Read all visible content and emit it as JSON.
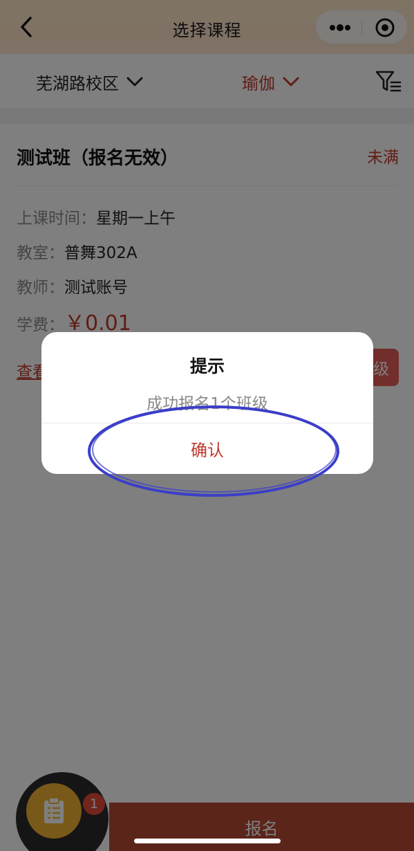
{
  "navbar": {
    "title": "选择课程",
    "back_icon": "chevron-left-icon",
    "more_icon": "more-dots-icon",
    "close_icon": "target-close-icon"
  },
  "filters": {
    "campus_label": "芜湖路校区",
    "course_label": "瑜伽",
    "filter_icon": "filter-icon"
  },
  "course_card": {
    "title": "测试班（报名无效）",
    "status": "未满",
    "time_label": "上课时间：",
    "time_value": "星期一上午",
    "room_label": "教室：",
    "room_value": "普舞302A",
    "teacher_label": "教师：",
    "teacher_value": "测试账号",
    "fee_label": "学费：",
    "fee_value": "￥0.01",
    "link_text": "查看",
    "action_text": "级"
  },
  "bottom_bar": {
    "cart_badge": "1",
    "register_label": "报名"
  },
  "dialog": {
    "title": "提示",
    "content": "成功报名1个班级",
    "confirm_label": "确认"
  },
  "colors": {
    "accent": "#c0392b",
    "register_bg": "#b84a35",
    "cart_bg": "#f2b335",
    "annotation": "#3b3fc7"
  }
}
